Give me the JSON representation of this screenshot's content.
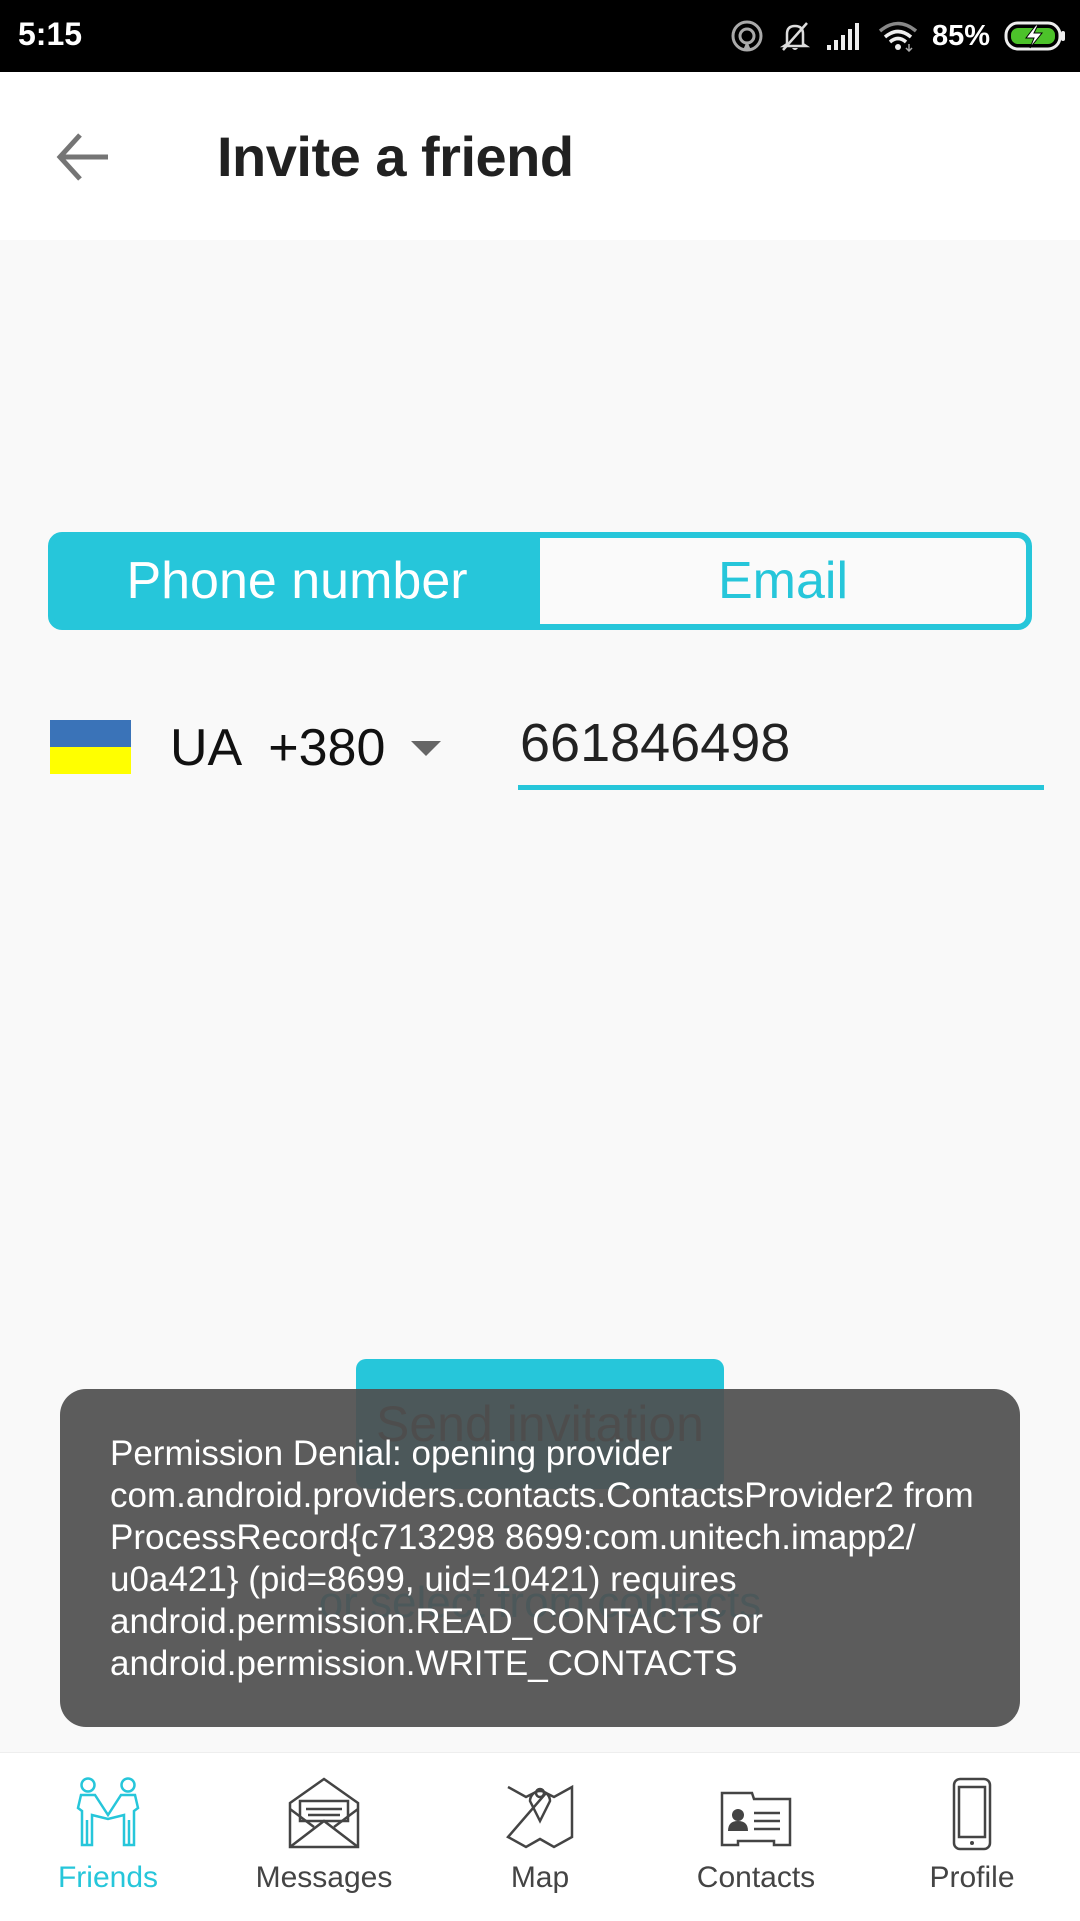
{
  "status_bar": {
    "time": "5:15",
    "battery_percent": "85%",
    "icons": [
      "hotspot-icon",
      "bell-muted-icon",
      "signal-icon",
      "wifi-icon",
      "battery-charging-icon"
    ]
  },
  "app_bar": {
    "title": "Invite a friend",
    "back_icon": "arrow-left-icon"
  },
  "segmented_control": {
    "options": [
      {
        "label": "Phone number",
        "selected": true
      },
      {
        "label": "Email",
        "selected": false
      }
    ]
  },
  "phone_form": {
    "country_code": "UA",
    "dial_code": "+380",
    "country_display": "UA  +380",
    "flag_colors": [
      "#3a73b8",
      "#ffff00"
    ],
    "phone_value": "661846498"
  },
  "actions": {
    "send_label": "Send invitation",
    "select_contacts_label": "or select from contacts"
  },
  "toast": {
    "lines": [
      "Permission Denial: opening provider",
      "com.android.providers.contacts.ContactsProvider2 from",
      "ProcessRecord{c713298 8699:com.unitech.imapp2/",
      "u0a421} (pid=8699, uid=10421) requires",
      "android.permission.READ_CONTACTS or",
      "android.permission.WRITE_CONTACTS"
    ]
  },
  "bottom_nav": {
    "items": [
      {
        "label": "Friends",
        "icon": "friends-icon",
        "active": true
      },
      {
        "label": "Messages",
        "icon": "envelope-icon",
        "active": false
      },
      {
        "label": "Map",
        "icon": "map-icon",
        "active": false
      },
      {
        "label": "Contacts",
        "icon": "contact-card-icon",
        "active": false
      },
      {
        "label": "Profile",
        "icon": "phone-device-icon",
        "active": false
      }
    ]
  },
  "colors": {
    "accent": "#26c6da",
    "toast_bg": "#5a5a5a",
    "text_dark": "#212121",
    "icon_gray": "#444444"
  }
}
